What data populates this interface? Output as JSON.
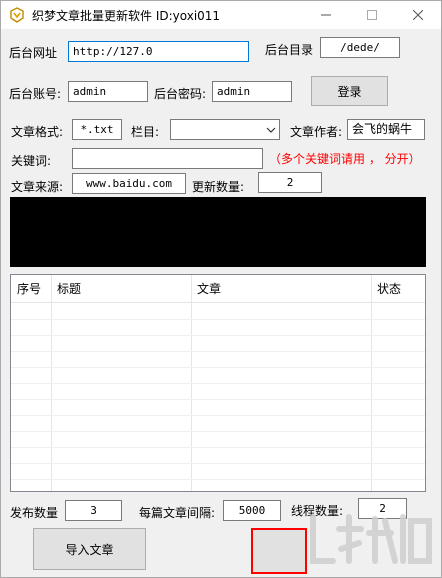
{
  "window": {
    "title": "织梦文章批量更新软件   ID:yoxi011",
    "controls": [
      "minimize",
      "maximize",
      "close"
    ]
  },
  "form": {
    "site_url_label": "后台网址",
    "site_url_value": "http://127.0",
    "admin_dir_label": "后台目录",
    "admin_dir_value": "/dede/",
    "account_label": "后台账号:",
    "account_value": "admin",
    "password_label": "后台密码:",
    "password_value": "admin",
    "login_button": "登录",
    "format_label": "文章格式:",
    "format_value": "*.txt",
    "column_label": "栏目:",
    "column_value": "",
    "author_label": "文章作者:",
    "author_value": "会飞的蜗牛",
    "keywords_label": "关键词:",
    "keywords_value": "",
    "keywords_hint": "（多个关键词请用 ， 分开）",
    "source_label": "文章来源:",
    "source_value": "www.baidu.com",
    "update_count_label": "更新数量:",
    "update_count_value": "2"
  },
  "table": {
    "columns": [
      "序号",
      "标题",
      "文章",
      "状态"
    ],
    "rows": []
  },
  "footer": {
    "publish_count_label": "发布数量",
    "publish_count_value": "3",
    "interval_label": "每篇文章间隔:",
    "interval_value": "5000",
    "threads_label": "线程数量:",
    "threads_value": "2",
    "import_button": "导入文章",
    "start_button": ""
  },
  "colors": {
    "hint_red": "#ff0000",
    "focus_blue": "#0078d7",
    "log_background": "#000000"
  }
}
